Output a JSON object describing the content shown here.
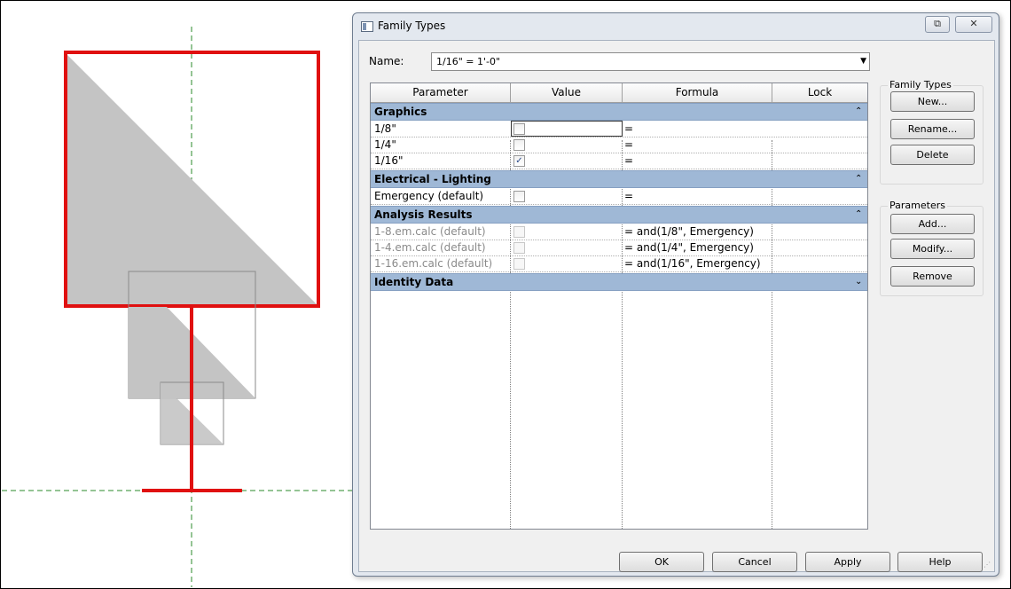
{
  "dialog": {
    "title": "Family Types",
    "name_label": "Name:",
    "name_value": "1/16\" = 1'-0\""
  },
  "grid": {
    "headers": [
      "Parameter",
      "Value",
      "Formula",
      "Lock"
    ],
    "groups": {
      "graphics": "Graphics",
      "electrical": "Electrical - Lighting",
      "analysis": "Analysis Results",
      "identity": "Identity Data"
    },
    "graphics_rows": [
      {
        "param": "1/8\"",
        "checked": false,
        "formula": "="
      },
      {
        "param": "1/4\"",
        "checked": false,
        "formula": "="
      },
      {
        "param": "1/16\"",
        "checked": true,
        "formula": "="
      }
    ],
    "electrical_rows": [
      {
        "param": "Emergency (default)",
        "checked": false,
        "formula": "="
      }
    ],
    "analysis_rows": [
      {
        "param": "1-8.em.calc (default)",
        "checked": false,
        "formula": "= and(1/8\", Emergency)"
      },
      {
        "param": "1-4.em.calc (default)",
        "checked": false,
        "formula": "= and(1/4\", Emergency)"
      },
      {
        "param": "1-16.em.calc (default)",
        "checked": false,
        "formula": "= and(1/16\", Emergency)"
      }
    ],
    "check_mark": "✓"
  },
  "family_types": {
    "label": "Family Types",
    "new": "New...",
    "rename": "Rename...",
    "delete": "Delete"
  },
  "parameters": {
    "label": "Parameters",
    "add": "Add...",
    "modify": "Modify...",
    "remove": "Remove"
  },
  "footer": {
    "ok": "OK",
    "cancel": "Cancel",
    "apply": "Apply",
    "help": "Help"
  },
  "icons": {
    "collapse": "⌃",
    "expand": "⌄",
    "dropdown": "▼"
  },
  "colors": {
    "symbol_red": "#e01010",
    "symbol_fill": "#c4c4c4",
    "guide_green": "#2a8a2a",
    "group_header": "#9fb8d6"
  }
}
